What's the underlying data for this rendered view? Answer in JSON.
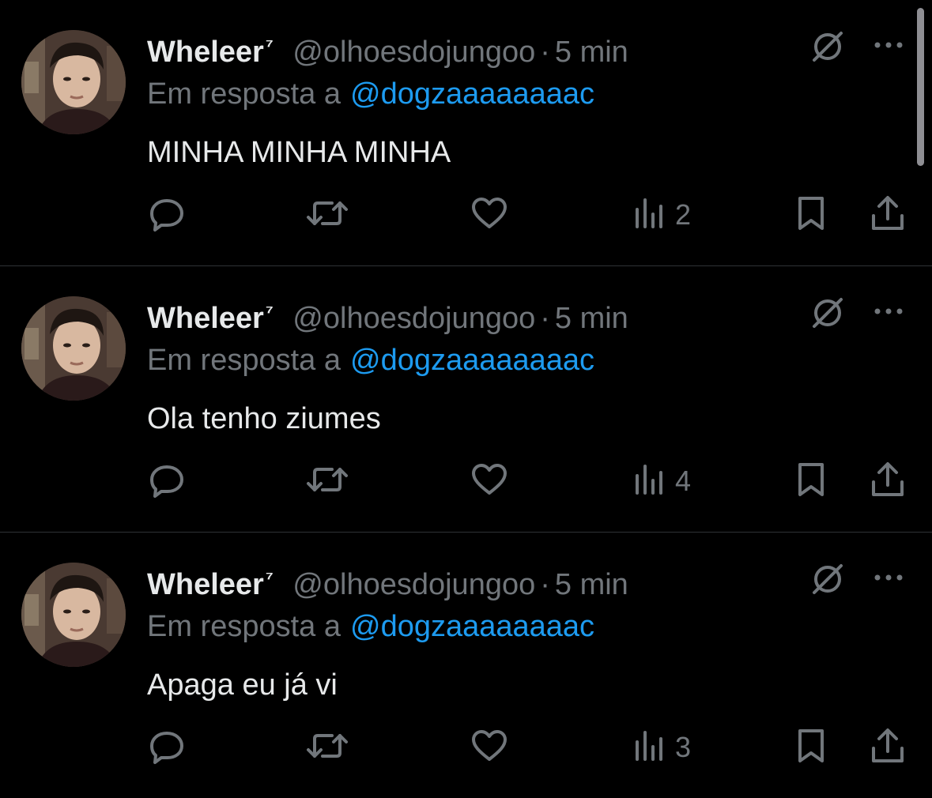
{
  "tweets": [
    {
      "display_name": "Wheleer",
      "badge": "⁷",
      "handle": "@olhoesdojungoo",
      "separator": "·",
      "time": "5 min",
      "reply_prefix": "Em resposta a",
      "reply_to": "@dogzaaaaaaaac",
      "text": "MINHA MINHA MINHA",
      "views": "2"
    },
    {
      "display_name": "Wheleer",
      "badge": "⁷",
      "handle": "@olhoesdojungoo",
      "separator": "·",
      "time": "5 min",
      "reply_prefix": "Em resposta a",
      "reply_to": "@dogzaaaaaaaac",
      "text": "Ola tenho ziumes",
      "views": "4"
    },
    {
      "display_name": "Wheleer",
      "badge": "⁷",
      "handle": "@olhoesdojungoo",
      "separator": "·",
      "time": "5 min",
      "reply_prefix": "Em resposta a",
      "reply_to": "@dogzaaaaaaaac",
      "text": "Apaga eu já vi",
      "views": "3"
    }
  ],
  "icons": {
    "reply": "reply-icon",
    "retweet": "retweet-icon",
    "like": "heart-icon",
    "views": "views-icon",
    "bookmark": "bookmark-icon",
    "share": "share-icon",
    "mute": "mute-icon",
    "more": "more-icon"
  },
  "colors": {
    "background": "#000000",
    "text": "#e7e9ea",
    "secondary": "#71767b",
    "link": "#1d9bf0",
    "divider": "#2f3336"
  }
}
